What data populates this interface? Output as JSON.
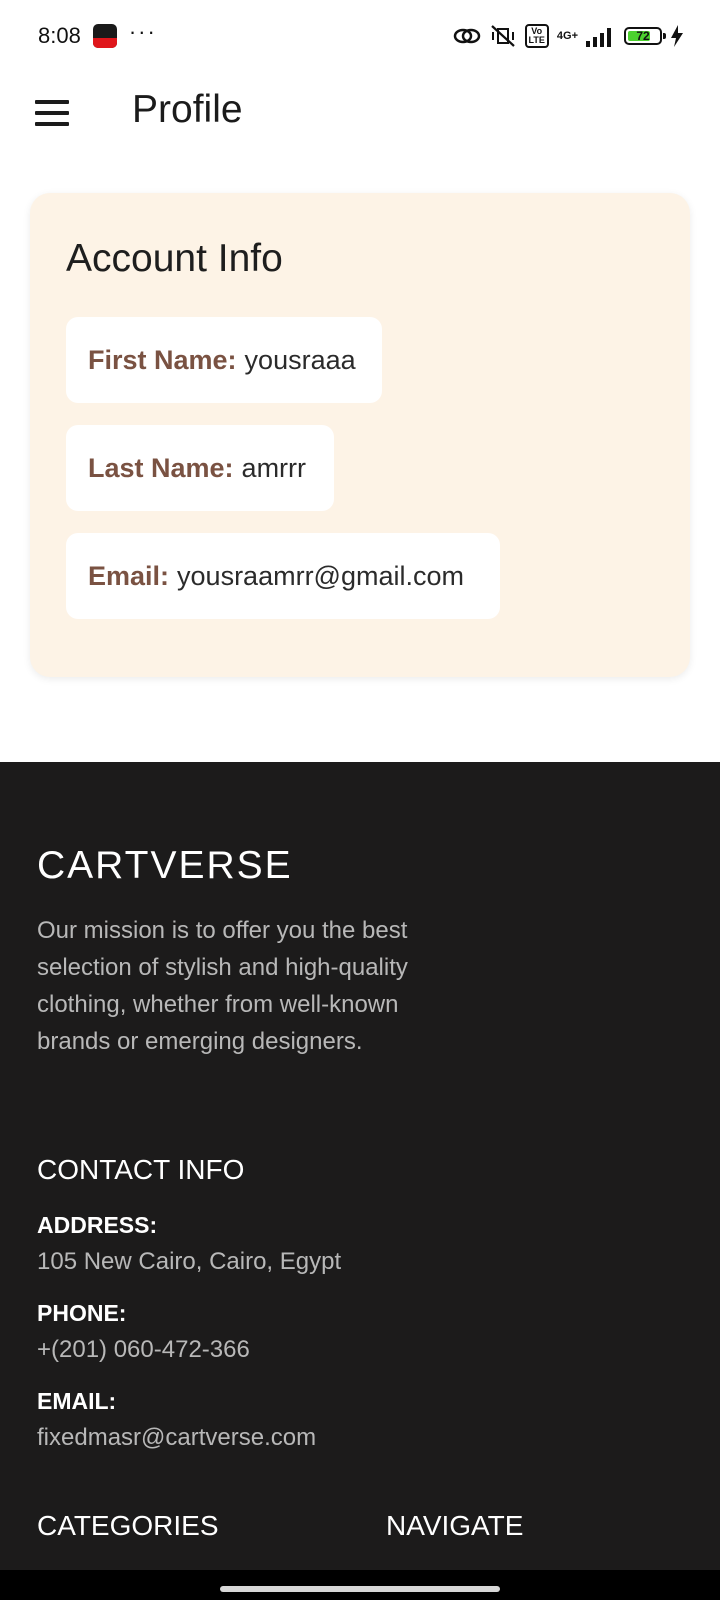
{
  "status_bar": {
    "time": "8:08",
    "more": "···",
    "volte_top": "Vo",
    "volte_bottom": "LTE",
    "network": "4G+",
    "battery": "72",
    "battery_level": 0.72,
    "icons": [
      "app-notification-icon",
      "link-icon",
      "vibrate-off-icon",
      "signal-icon",
      "battery-icon",
      "charging-icon"
    ]
  },
  "app_bar": {
    "title": "Profile",
    "menu_icon": "hamburger-menu-icon"
  },
  "account": {
    "title": "Account Info",
    "first_name_label": "First Name:",
    "first_name": "yousraaa",
    "last_name_label": "Last Name:",
    "last_name": "amrrr",
    "email_label": "Email:",
    "email": "yousraamrr@gmail.com"
  },
  "footer": {
    "brand": "CARTVERSE",
    "mission": "Our mission is to offer you the best selection of stylish and high-quality clothing, whether from well-known brands or emerging designers.",
    "contact_heading": "CONTACT INFO",
    "address_label": "ADDRESS:",
    "address": "105 New Cairo, Cairo, Egypt",
    "phone_label": "PHONE:",
    "phone": "+(201) 060-472-366",
    "email_label": "EMAIL:",
    "email": "fixedmasr@cartverse.com",
    "categories_heading": "CATEGORIES",
    "navigate_heading": "NAVIGATE"
  },
  "colors": {
    "card_bg": "#fdf3e6",
    "label_brown": "#7a5242",
    "footer_bg": "#1c1b1b",
    "battery_green": "#4cd12e"
  }
}
